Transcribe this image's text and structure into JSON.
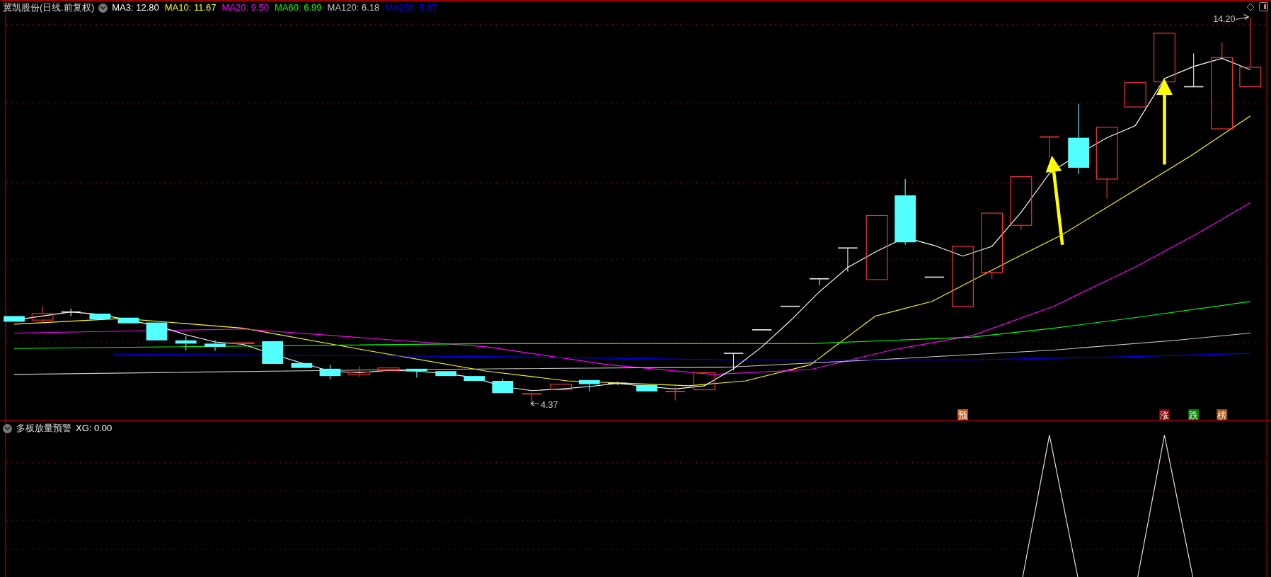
{
  "main_panel": {
    "title": "冀凯股份(日线.前复权)",
    "indicators": [
      {
        "label": "MA3: 12.80",
        "color": "#ffffff"
      },
      {
        "label": "MA10: 11.67",
        "color": "#ffff00"
      },
      {
        "label": "MA20: 9.50",
        "color": "#ff00ff"
      },
      {
        "label": "MA60: 6.99",
        "color": "#00ff00"
      },
      {
        "label": "MA120: 6.18",
        "color": "#c8c8c8"
      },
      {
        "label": "MA250: 5.67",
        "color": "#0000ff"
      }
    ],
    "high_label": "14.20",
    "low_label": "4.37",
    "signals": [
      {
        "label": "预",
        "color": "#c0561a"
      },
      {
        "label": "涨",
        "color": "#8b0000"
      },
      {
        "label": "跌",
        "color": "#0a7a0a"
      },
      {
        "label": "榜",
        "color": "#a0520a"
      }
    ]
  },
  "sub_panel": {
    "title": "多板放量预警",
    "indicators": [
      {
        "label": "XG: 0.00",
        "color": "#ffffff"
      }
    ]
  }
}
